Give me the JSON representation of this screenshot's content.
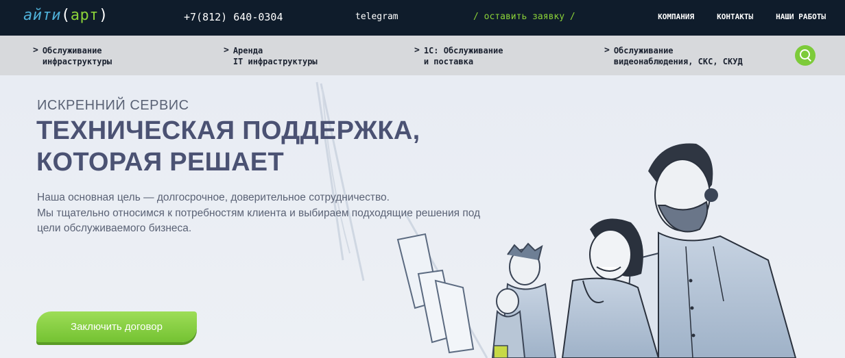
{
  "header": {
    "logo": {
      "part1": "айти",
      "open": "(",
      "part2": "арт",
      "close": ")"
    },
    "phone": "+7(812) 640-0304",
    "telegram": "telegram",
    "request": "/ оставить заявку /",
    "nav": [
      "КОМПАНИЯ",
      "КОНТАКТЫ",
      "НАШИ РАБОТЫ"
    ]
  },
  "menu": [
    {
      "line1": "Обслуживание",
      "line2": "инфраструктуры"
    },
    {
      "line1": "Аренда",
      "line2": "IT инфраструктуры"
    },
    {
      "line1": "1С: Обслуживание",
      "line2": "и поставка"
    },
    {
      "line1": "Обслуживание",
      "line2": "видеонаблюдения, СКС, СКУД"
    }
  ],
  "menu_arrow": ">",
  "hero": {
    "kicker": "ИСКРЕННИЙ СЕРВИС",
    "headline_line1": "ТЕХНИЧЕСКАЯ ПОДДЕРЖКА,",
    "headline_line2": "КОТОРАЯ РЕШАЕТ",
    "lead_line1": "Наша основная цель — долгосрочное, доверительное сотрудничество.",
    "lead_line2": "Мы тщательно относимся к потребностям клиента и выбираем подходящие решения под",
    "lead_line3": "цели обслуживаемого бизнеса.",
    "cta": "Заключить договор"
  },
  "colors": {
    "header_bg": "#0f1c2b",
    "accent_green": "#8bd238",
    "menu_bg": "#d7d9dc",
    "headline": "#4b5273"
  },
  "icons": [
    "search-icon",
    "chevron-right-icon"
  ]
}
